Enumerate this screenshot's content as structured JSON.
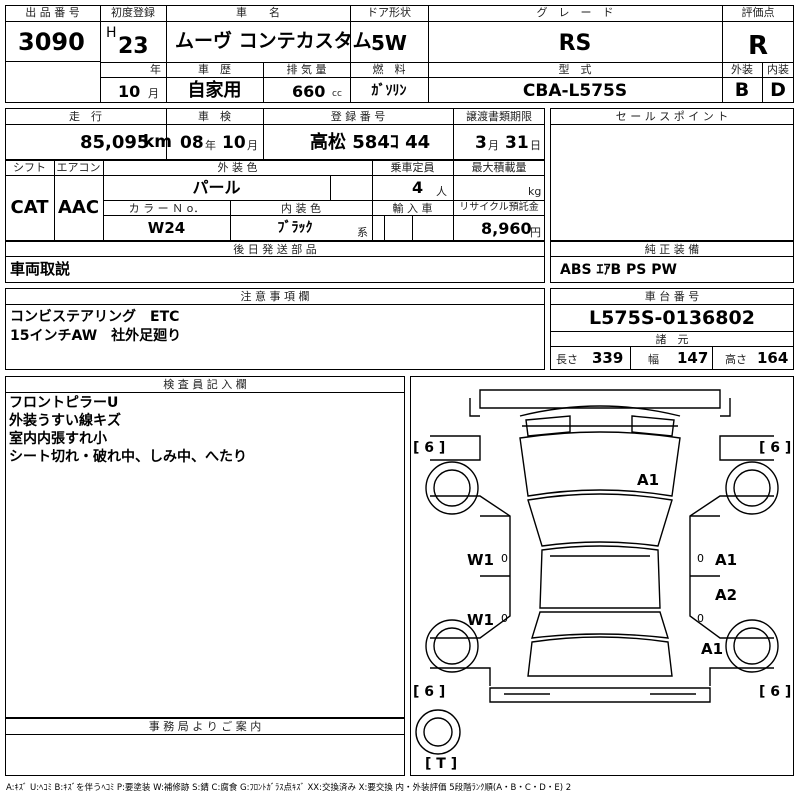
{
  "top": {
    "lot_no_label": "出 品 番 号",
    "lot_no": "3090",
    "first_reg_label": "初度登録",
    "era": "H",
    "year": "23",
    "year_unit": "年",
    "month": "10",
    "month_unit": "月",
    "car_name_label": "車　　名",
    "car_name": "ムーヴ コンテカスタム",
    "door_label": "ドア形状",
    "door": "5W",
    "grade_label": "グ　レ　ー　ド",
    "grade": "RS",
    "score_label": "評価点",
    "score": "R",
    "history_label": "車　歴",
    "history": "自家用",
    "displacement_label": "排 気 量",
    "displacement": "660",
    "displacement_unit": "cc",
    "fuel_label": "燃　料",
    "fuel": "ｶﾞｿﾘﾝ",
    "model_label": "型　式",
    "model": "CBA-L575S",
    "ext_label": "外装",
    "ext": "B",
    "int_label": "内装",
    "int": "D"
  },
  "second": {
    "mileage_label": "走　行",
    "mileage": "85,095",
    "mileage_unit": "km",
    "inspection_label": "車　検",
    "insp_year": "08",
    "insp_year_unit": "年",
    "insp_month": "10",
    "insp_month_unit": "月",
    "reg_no_label": "登 録 番 号",
    "reg_no": "高松 584ｺ 44",
    "transfer_label": "譲渡書類期限",
    "transfer_month": "3",
    "transfer_month_unit": "月",
    "transfer_day": "31",
    "transfer_day_unit": "日",
    "sales_point_label": "セ ー ル ス ポ イ ン ト"
  },
  "third": {
    "shift_label": "シフト",
    "shift": "CAT",
    "aircon_label": "エアコン",
    "aircon": "AAC",
    "exterior_color_label": "外 装 色",
    "exterior_color": "パール",
    "capacity_label": "乗車定員",
    "capacity": "4",
    "capacity_unit": "人",
    "max_load_label": "最大積載量",
    "max_load_unit": "kg",
    "color_no_label": "カ ラ ー Ｎ o．",
    "color_no": "W24",
    "interior_color_label": "内 装 色",
    "interior_color": "ﾌﾞﾗｯｸ",
    "interior_color_unit": "系",
    "import_label": "輸 入 車",
    "recycle_label": "リサイクル預託金",
    "recycle": "8,960",
    "recycle_unit": "円"
  },
  "later_parts": {
    "label": "後 日 発 送 部 品",
    "value": "車両取説"
  },
  "genuine": {
    "label": "純 正 装 備",
    "value": "ABS ｴｱB PS PW"
  },
  "notes": {
    "label": "注 意 事 項 欄",
    "line1": "コンビステアリング　ETC",
    "line2": "15インチAW　社外足廻り"
  },
  "chassis": {
    "label": "車 台 番 号",
    "value": "L575S-0136802"
  },
  "specs": {
    "label": "諸　元",
    "length_label": "長さ",
    "length": "339",
    "width_label": "幅",
    "width": "147",
    "height_label": "高さ",
    "height": "164"
  },
  "inspector": {
    "label": "検 査 員 記 入 欄",
    "lines": [
      "フロントピラーU",
      "外装うすい線キズ",
      "室内内張すれ小",
      "シート切れ・破れ中、しみ中、へたり"
    ]
  },
  "office": {
    "label": "事 務 局 よ り ご 案 内"
  },
  "diagram": {
    "tire_fl": "[ 6 ]",
    "tire_fr": "[ 6 ]",
    "tire_rl": "[ 6 ]",
    "tire_rr": "[ 6 ]",
    "spare": "[ T ]",
    "mark_hood": "A1",
    "mark_w1_upper": "W1",
    "mark_w1_lower": "W1",
    "mark_a1_right_front": "A1",
    "mark_a2_right": "A2",
    "mark_a1_right_rear": "A1",
    "zero": "0"
  },
  "legend": "A:ｷｽﾞ U:ﾍｺﾐ B:ｷｽﾞを伴うﾍｺﾐ P:要塗装 W:補修跡 S:錆 C:腐食 G:ﾌﾛﾝﾄｶﾞﾗｽ点ｷｽﾞ XX:交換済み X:要交換 内・外装評価 5段階ﾗﾝｸ順(A・B・C・D・E) 2"
}
